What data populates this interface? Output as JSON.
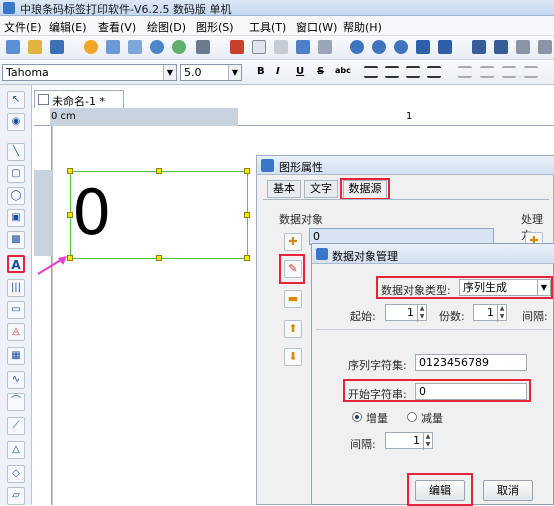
{
  "window": {
    "title": "中琅条码标签打印软件-V6.2.5 数码版 单机"
  },
  "menu": [
    "文件(E)",
    "编辑(E)",
    "查看(V)",
    "绘图(D)",
    "图形(S)",
    "工具(T)",
    "窗口(W)",
    "帮助(H)"
  ],
  "format_bar": {
    "font": "Tahoma",
    "size": "5.0",
    "buttons": [
      "B",
      "I",
      "U",
      "S",
      "abc"
    ]
  },
  "document": {
    "tab": "未命名-1 *",
    "ruler_zero": "0 cm",
    "ruler_one": "1",
    "barcode_text": "0"
  },
  "left_tools": [
    "line",
    "rect",
    "ellipse",
    "image",
    "picture",
    "A",
    "barcode",
    "qr",
    "polygon",
    "graph",
    "curve",
    "arc",
    "pen",
    "triangle",
    "diamond",
    "parallelogram"
  ],
  "graphic_dialog": {
    "title": "图形属性",
    "tabs": [
      "基本",
      "文字",
      "数据源"
    ],
    "data_object_label": "数据对象",
    "processing_label": "处理方",
    "data_list_value": "0"
  },
  "data_object_dialog": {
    "title": "数据对象管理",
    "type_label": "数据对象类型:",
    "type_value": "序列生成",
    "start_label": "起始:",
    "start_value": "1",
    "count_label": "份数:",
    "count_value": "1",
    "interval_label_top": "间隔:",
    "charset_label": "序列字符集:",
    "charset_value": "0123456789",
    "start_string_label": "开始字符串:",
    "start_string_value": "0",
    "increase_label": "增量",
    "decrease_label": "减量",
    "interval_label": "间隔:",
    "interval_value": "1",
    "edit_button": "编辑",
    "cancel_button": "取消"
  },
  "colors": {
    "highlight": "#e5253b",
    "selection": "#57c240",
    "handle": "#ffe600",
    "arrow": "#e83ccf"
  }
}
